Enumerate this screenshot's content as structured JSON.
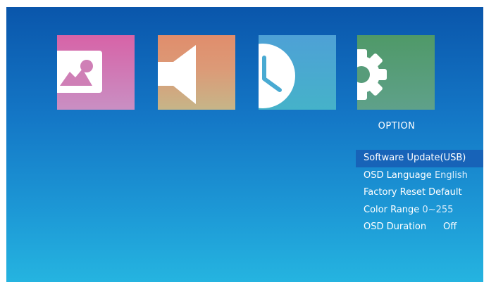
{
  "tiles": [
    {
      "id": "picture",
      "icon": "picture-icon"
    },
    {
      "id": "sound",
      "icon": "speaker-icon"
    },
    {
      "id": "time",
      "icon": "clock-icon"
    },
    {
      "id": "option",
      "icon": "gear-icon"
    }
  ],
  "menu": {
    "title": "OPTION",
    "items": [
      {
        "label": "Software Update(USB)",
        "value": "",
        "selected": true
      },
      {
        "label": "OSD Language",
        "value": "English"
      },
      {
        "label": "Factory Reset Default",
        "value": ""
      },
      {
        "label": "Color Range",
        "value": "0~255"
      },
      {
        "label": "OSD Duration",
        "value": "Off"
      }
    ]
  },
  "colors": {
    "background_top": "#0a56ab",
    "background_bottom": "#25b4e0",
    "selection": "#1763b8"
  }
}
